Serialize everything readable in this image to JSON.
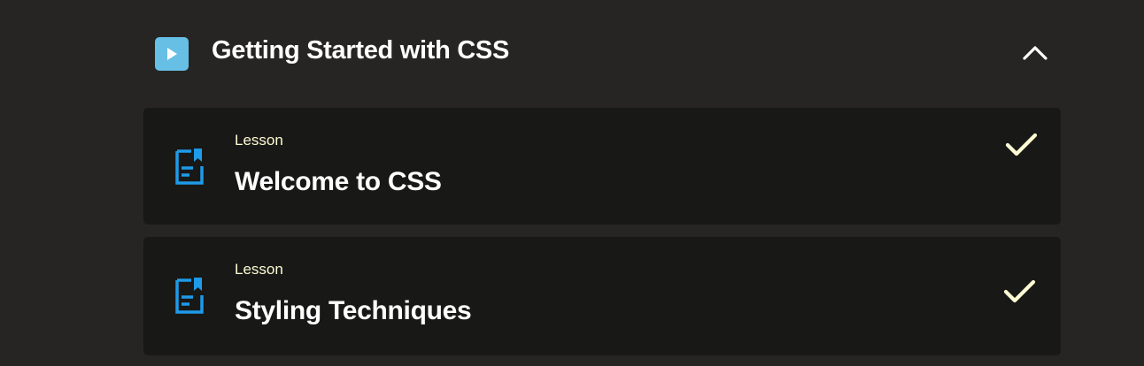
{
  "module": {
    "title": "Getting Started with CSS",
    "icon": "play-icon",
    "collapse_icon": "chevron-up-icon"
  },
  "lessons": [
    {
      "type": "Lesson",
      "title": "Welcome to CSS",
      "icon": "lesson-document-icon",
      "status_icon": "checkmark-icon"
    },
    {
      "type": "Lesson",
      "title": "Styling Techniques",
      "icon": "lesson-document-icon",
      "status_icon": "checkmark-icon"
    }
  ],
  "colors": {
    "background": "#262523",
    "card": "#181817",
    "accent_blue": "#1e9be9",
    "module_icon": "#67bfe6",
    "label_cream": "#fdfbd3",
    "text": "#ffffff"
  }
}
